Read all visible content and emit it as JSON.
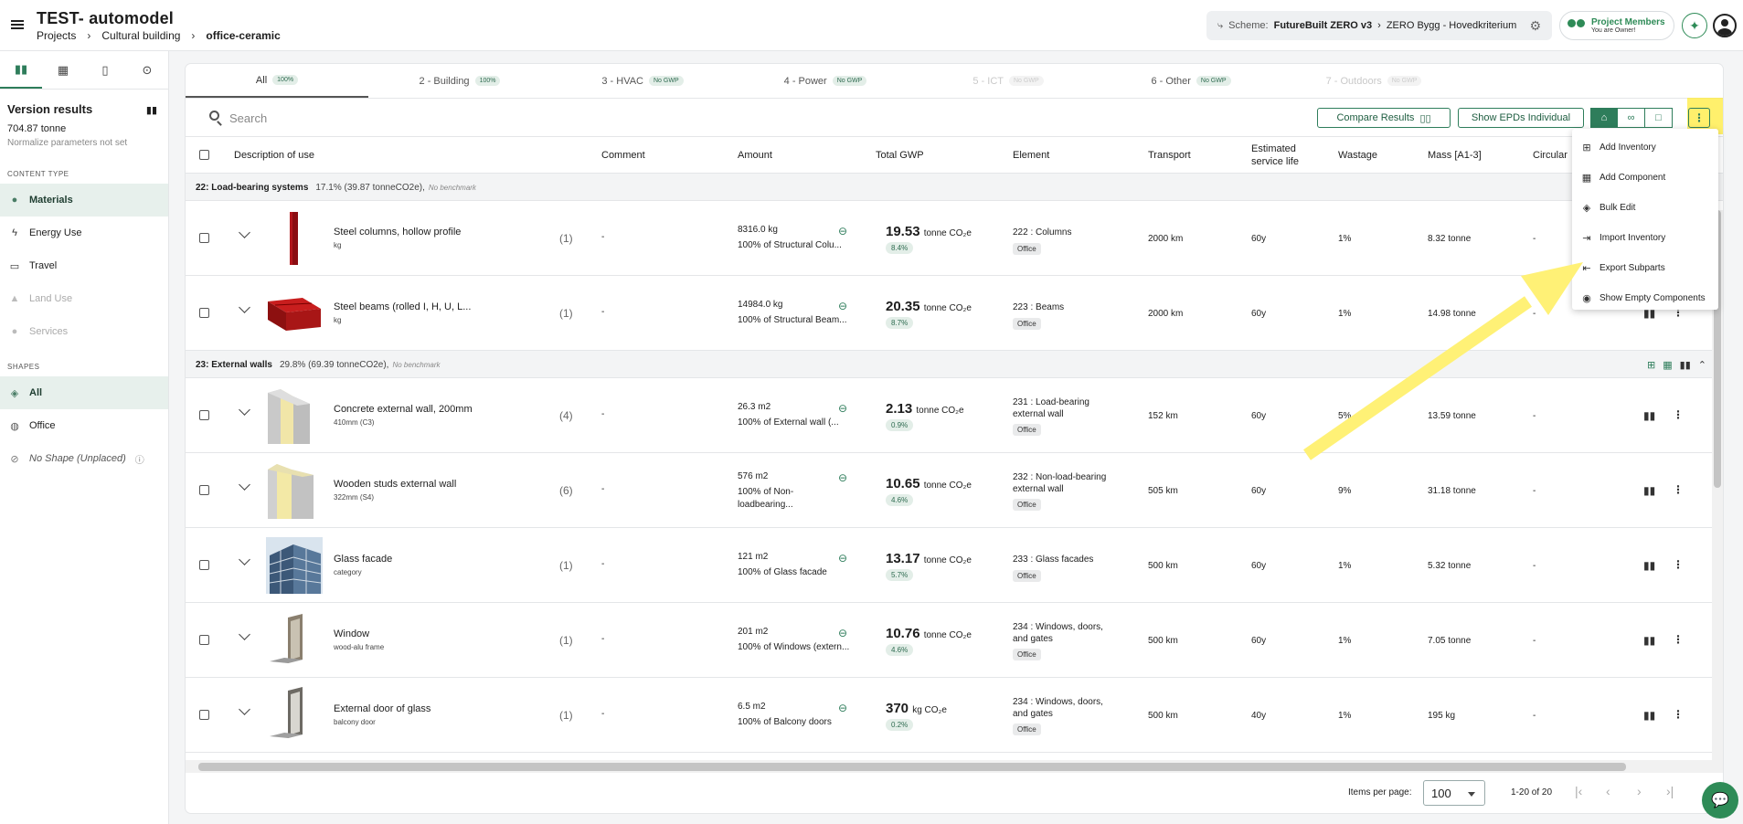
{
  "header": {
    "title": "TEST- automodel",
    "breadcrumb": [
      "Projects",
      "Cultural building",
      "office-ceramic"
    ],
    "scheme_label": "Scheme:",
    "scheme_value": "FutureBuilt ZERO v3",
    "scheme_sub": "ZERO Bygg - Hovedkriterium",
    "members_title": "Project Members",
    "members_sub": "You are Owner!"
  },
  "sidebar": {
    "version_title": "Version results",
    "total": "704.87 tonne",
    "normalize_note": "Normalize parameters not set",
    "content_type_heading": "CONTENT TYPE",
    "content_items": [
      {
        "label": "Materials",
        "icon": "materials-icon"
      },
      {
        "label": "Energy Use",
        "icon": "energy-icon"
      },
      {
        "label": "Travel",
        "icon": "car-icon"
      },
      {
        "label": "Land Use",
        "icon": "land-icon"
      },
      {
        "label": "Services",
        "icon": "person-icon"
      }
    ],
    "shapes_heading": "SHAPES",
    "shape_items": [
      {
        "label": "All"
      },
      {
        "label": "Office"
      },
      {
        "label": "No Shape (Unplaced)"
      }
    ]
  },
  "tabs": [
    {
      "label": "All",
      "badge": "100%"
    },
    {
      "label": "2 - Building",
      "badge": "100%"
    },
    {
      "label": "3 - HVAC",
      "badge": "No GWP"
    },
    {
      "label": "4 - Power",
      "badge": "No GWP"
    },
    {
      "label": "5 - ICT",
      "badge": "No GWP"
    },
    {
      "label": "6 - Other",
      "badge": "No GWP"
    },
    {
      "label": "7 - Outdoors",
      "badge": "No GWP"
    }
  ],
  "toolbar": {
    "search_placeholder": "Search",
    "compare_label": "Compare Results",
    "show_epds_label": "Show EPDs Individual"
  },
  "columns": {
    "description": "Description of use",
    "comment": "Comment",
    "amount": "Amount",
    "total_gwp": "Total GWP",
    "element": "Element",
    "transport": "Transport",
    "service_life_1": "Estimated",
    "service_life_2": "service life",
    "wastage": "Wastage",
    "mass": "Mass [A1-3]",
    "circularity": "Circular"
  },
  "groups": [
    {
      "title": "22: Load-bearing systems",
      "pct": "17.1% (39.87 tonneCO2e),",
      "bench": "No benchmark"
    },
    {
      "title": "23: External walls",
      "pct": "29.8% (69.39 tonneCO2e),",
      "bench": "No benchmark"
    }
  ],
  "rows": [
    {
      "name": "Steel columns, hollow profile",
      "sub": "kg",
      "count": "(1)",
      "comment": "-",
      "amount": "8316.0 kg",
      "amount_of": "100% of Structural Colu...",
      "gwp": "19.53",
      "gwp_unit": "tonne CO₂e",
      "gwp_pct": "8.4%",
      "element": "222 : Columns",
      "shape": "Office",
      "transport": "2000 km",
      "life": "60y",
      "waste": "1%",
      "mass": "8.32 tonne",
      "circ": "-"
    },
    {
      "name": "Steel beams (rolled I, H, U, L...",
      "sub": "kg",
      "count": "(1)",
      "comment": "-",
      "amount": "14984.0 kg",
      "amount_of": "100% of Structural Beam...",
      "gwp": "20.35",
      "gwp_unit": "tonne CO₂e",
      "gwp_pct": "8.7%",
      "element": "223 : Beams",
      "shape": "Office",
      "transport": "2000 km",
      "life": "60y",
      "waste": "1%",
      "mass": "14.98 tonne",
      "circ": "-"
    },
    {
      "name": "Concrete external wall, 200mm",
      "sub": "410mm (C3)",
      "count": "(4)",
      "comment": "-",
      "amount": "26.3 m2",
      "amount_of": "100% of External wall (...",
      "gwp": "2.13",
      "gwp_unit": "tonne CO₂e",
      "gwp_pct": "0.9%",
      "element": "231 : Load-bearing external wall",
      "shape": "Office",
      "transport": "152 km",
      "life": "60y",
      "waste": "5%",
      "mass": "13.59 tonne",
      "circ": "-"
    },
    {
      "name": "Wooden studs external wall",
      "sub": "322mm (S4)",
      "count": "(6)",
      "comment": "-",
      "amount": "576 m2",
      "amount_of": "100% of Non-loadbearing...",
      "gwp": "10.65",
      "gwp_unit": "tonne CO₂e",
      "gwp_pct": "4.6%",
      "element": "232 : Non-load-bearing external wall",
      "shape": "Office",
      "transport": "505 km",
      "life": "60y",
      "waste": "9%",
      "mass": "31.18 tonne",
      "circ": "-"
    },
    {
      "name": "Glass facade",
      "sub": "category",
      "count": "(1)",
      "comment": "-",
      "amount": "121 m2",
      "amount_of": "100% of Glass facade",
      "gwp": "13.17",
      "gwp_unit": "tonne CO₂e",
      "gwp_pct": "5.7%",
      "element": "233 : Glass facades",
      "shape": "Office",
      "transport": "500 km",
      "life": "60y",
      "waste": "1%",
      "mass": "5.32 tonne",
      "circ": "-"
    },
    {
      "name": "Window",
      "sub": "wood-alu frame",
      "count": "(1)",
      "comment": "-",
      "amount": "201 m2",
      "amount_of": "100% of Windows (extern...",
      "gwp": "10.76",
      "gwp_unit": "tonne CO₂e",
      "gwp_pct": "4.6%",
      "element": "234 : Windows, doors, and gates",
      "shape": "Office",
      "transport": "500 km",
      "life": "60y",
      "waste": "1%",
      "mass": "7.05 tonne",
      "circ": "-"
    },
    {
      "name": "External door of glass",
      "sub": "balcony door",
      "count": "(1)",
      "comment": "-",
      "amount": "6.5 m2",
      "amount_of": "100% of Balcony doors",
      "gwp": "370",
      "gwp_unit": "kg CO₂e",
      "gwp_pct": "0.2%",
      "element": "234 : Windows, doors, and gates",
      "shape": "Office",
      "transport": "500 km",
      "life": "40y",
      "waste": "1%",
      "mass": "195 kg",
      "circ": "-"
    }
  ],
  "footer": {
    "items_per_page_label": "Items per page:",
    "items_per_page": "100",
    "range": "1-20 of 20"
  },
  "menu": [
    {
      "label": "Add Inventory",
      "icon": "add-box-icon"
    },
    {
      "label": "Add Component",
      "icon": "grid-add-icon"
    },
    {
      "label": "Bulk Edit",
      "icon": "layers-icon"
    },
    {
      "label": "Import Inventory",
      "icon": "import-icon"
    },
    {
      "label": "Export Subparts",
      "icon": "export-icon"
    },
    {
      "label": "Show Empty Components",
      "icon": "eye-icon"
    }
  ],
  "colors": {
    "accent": "#2e7d5b",
    "highlight": "#ffeb3b"
  }
}
